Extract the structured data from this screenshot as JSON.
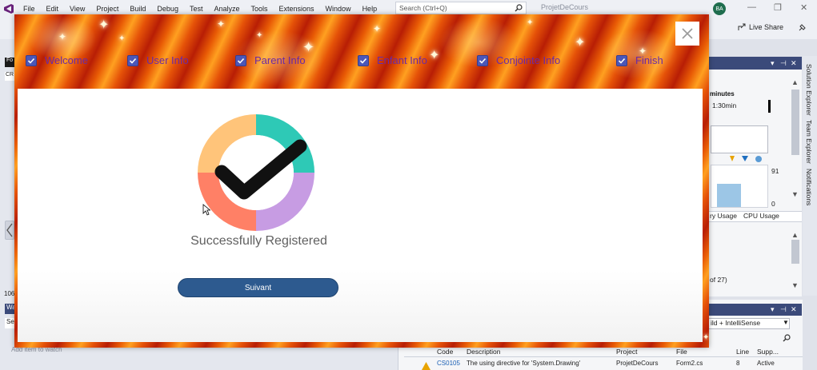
{
  "vs": {
    "menu": [
      "File",
      "Edit",
      "View",
      "Project",
      "Build",
      "Debug",
      "Test",
      "Analyze",
      "Tools",
      "Extensions",
      "Window",
      "Help"
    ],
    "search_placeholder": "Search (Ctrl+Q)",
    "solution_name": "ProjetDeCours",
    "avatar_initials": "BA",
    "live_share": "Live Share",
    "left_tab": "Fo",
    "left_box": "CR",
    "line_no": "106",
    "watch_tab": "Wa",
    "search_box": "Se",
    "add_watch": "Add item to watch"
  },
  "diagnostics": {
    "minutes_label": "minutes",
    "time_label": "1:30min",
    "value_max": "91",
    "value_min": "0",
    "tab_memory": "ry Usage",
    "tab_cpu": "CPU Usage",
    "paren": ")",
    "count": "of 27)"
  },
  "right_tabs": [
    "Solution Explorer",
    "Team Explorer",
    "Notifications"
  ],
  "errors": {
    "filter": "ild + IntelliSense",
    "headers": {
      "code": "Code",
      "description": "Description",
      "project": "Project",
      "file": "File",
      "line": "Line",
      "suppression": "Supp..."
    },
    "row": {
      "code": "CS0105",
      "description": "The using directive for 'System.Drawing'",
      "project": "ProjetDeCours",
      "file": "Form2.cs",
      "line": "8",
      "suppression": "Active"
    }
  },
  "wizard": {
    "steps": [
      {
        "label": "Welcome",
        "checked": true
      },
      {
        "label": "User Info",
        "checked": true
      },
      {
        "label": "Parent Info",
        "checked": true
      },
      {
        "label": "Enfant Info",
        "checked": true
      },
      {
        "label": "Conjointe Info",
        "checked": true
      },
      {
        "label": "Finish",
        "checked": true
      }
    ],
    "success_message": "Successfully Registered",
    "next_button": "Suivant",
    "ring_colors": [
      "#2ec9b6",
      "#c79ce3",
      "#ff8066",
      "#ffc47a"
    ],
    "check_color": "#111111"
  }
}
